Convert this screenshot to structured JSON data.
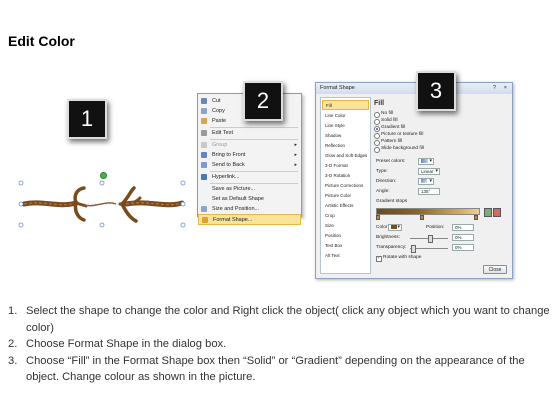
{
  "page": {
    "title": "Edit Color"
  },
  "steps": [
    "1",
    "2",
    "3"
  ],
  "context_menu": {
    "items": [
      {
        "label": "Cut",
        "icon": "scissors-icon",
        "enabled": true,
        "submenu": false
      },
      {
        "label": "Copy",
        "icon": "copy-icon",
        "enabled": true,
        "submenu": false
      },
      {
        "label": "Paste",
        "icon": "paste-icon",
        "enabled": true,
        "submenu": false
      },
      {
        "label": "Edit Text",
        "icon": "edit-text-icon",
        "enabled": true,
        "submenu": false
      },
      {
        "label": "Group",
        "icon": "group-icon",
        "enabled": false,
        "submenu": true
      },
      {
        "label": "Bring to Front",
        "icon": "bring-front-icon",
        "enabled": true,
        "submenu": true
      },
      {
        "label": "Send to Back",
        "icon": "send-back-icon",
        "enabled": true,
        "submenu": true
      },
      {
        "label": "Hyperlink...",
        "icon": "hyperlink-icon",
        "enabled": true,
        "submenu": false
      },
      {
        "label": "Save as Picture...",
        "icon": "",
        "enabled": true,
        "submenu": false
      },
      {
        "label": "Set as Default Shape",
        "icon": "",
        "enabled": true,
        "submenu": false
      },
      {
        "label": "Size and Position...",
        "icon": "size-position-icon",
        "enabled": true,
        "submenu": false
      },
      {
        "label": "Format Shape...",
        "icon": "format-shape-icon",
        "enabled": true,
        "submenu": false,
        "highlighted": true
      }
    ]
  },
  "format_dialog": {
    "title": "Format Shape",
    "help": "?",
    "close_x": "×",
    "nav": [
      "Fill",
      "Line Color",
      "Line Style",
      "Shadow",
      "Reflection",
      "Glow and Soft Edges",
      "3-D Format",
      "3-D Rotation",
      "Picture Corrections",
      "Picture Color",
      "Artistic Effects",
      "Crop",
      "Size",
      "Position",
      "Text Box",
      "Alt Text"
    ],
    "nav_selected": 0,
    "panel": {
      "heading": "Fill",
      "fill_options": [
        "No fill",
        "Solid fill",
        "Gradient fill",
        "Picture or texture fill",
        "Pattern fill",
        "Slide background fill"
      ],
      "fill_selected": 2,
      "preset_label": "Preset colors:",
      "type_label": "Type:",
      "type_value": "Linear",
      "direction_label": "Direction:",
      "angle_label": "Angle:",
      "angle_value": "135°",
      "gradient_stops_label": "Gradient stops",
      "color_label": "Color",
      "position_label": "Position:",
      "position_value": "0%",
      "brightness_label": "Brightness:",
      "brightness_value": "0%",
      "transparency_label": "Transparency:",
      "transparency_value": "0%",
      "rotate_label": "Rotate with shape"
    },
    "close_button": "Close"
  },
  "colors": {
    "rope": "#7a4a1f",
    "highlight": "#fbe49a",
    "gradient_start": "#6b4a1e",
    "gradient_end": "#f0d090"
  },
  "instructions": [
    {
      "num": "1.",
      "text": "Select the shape to change the color and Right click the object( click any object which you want to change color)"
    },
    {
      "num": "2.",
      "text": "Choose Format Shape in the dialog box."
    },
    {
      "num": "3.",
      "text": "Choose “Fill” in the Format Shape box then “Solid” or “Gradient” depending on the appearance of the object. Change colour as shown in the picture."
    }
  ]
}
